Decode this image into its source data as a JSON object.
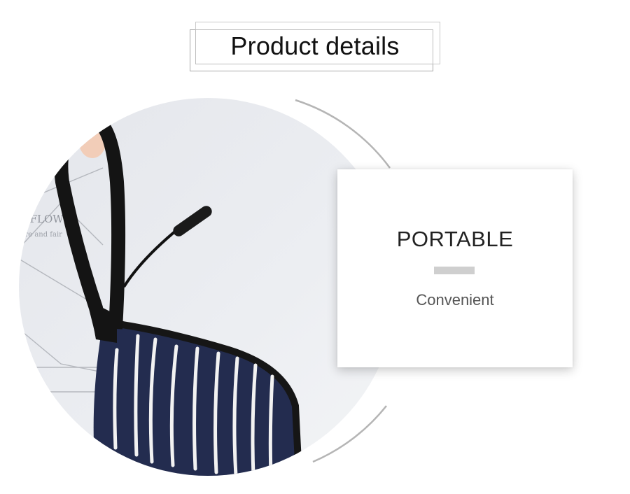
{
  "header": {
    "title": "Product details"
  },
  "photo": {
    "description_icon": "pouch-product-photo",
    "background_text": [
      "A FLOWE",
      "ure and fair"
    ]
  },
  "feature_card": {
    "heading": "PORTABLE",
    "subheading": "Convenient"
  },
  "colors": {
    "pouch_navy": "#232c4f",
    "strap_black": "#161616",
    "backdrop": "#e7e9ee",
    "divider_gray": "#cfcfcf"
  }
}
